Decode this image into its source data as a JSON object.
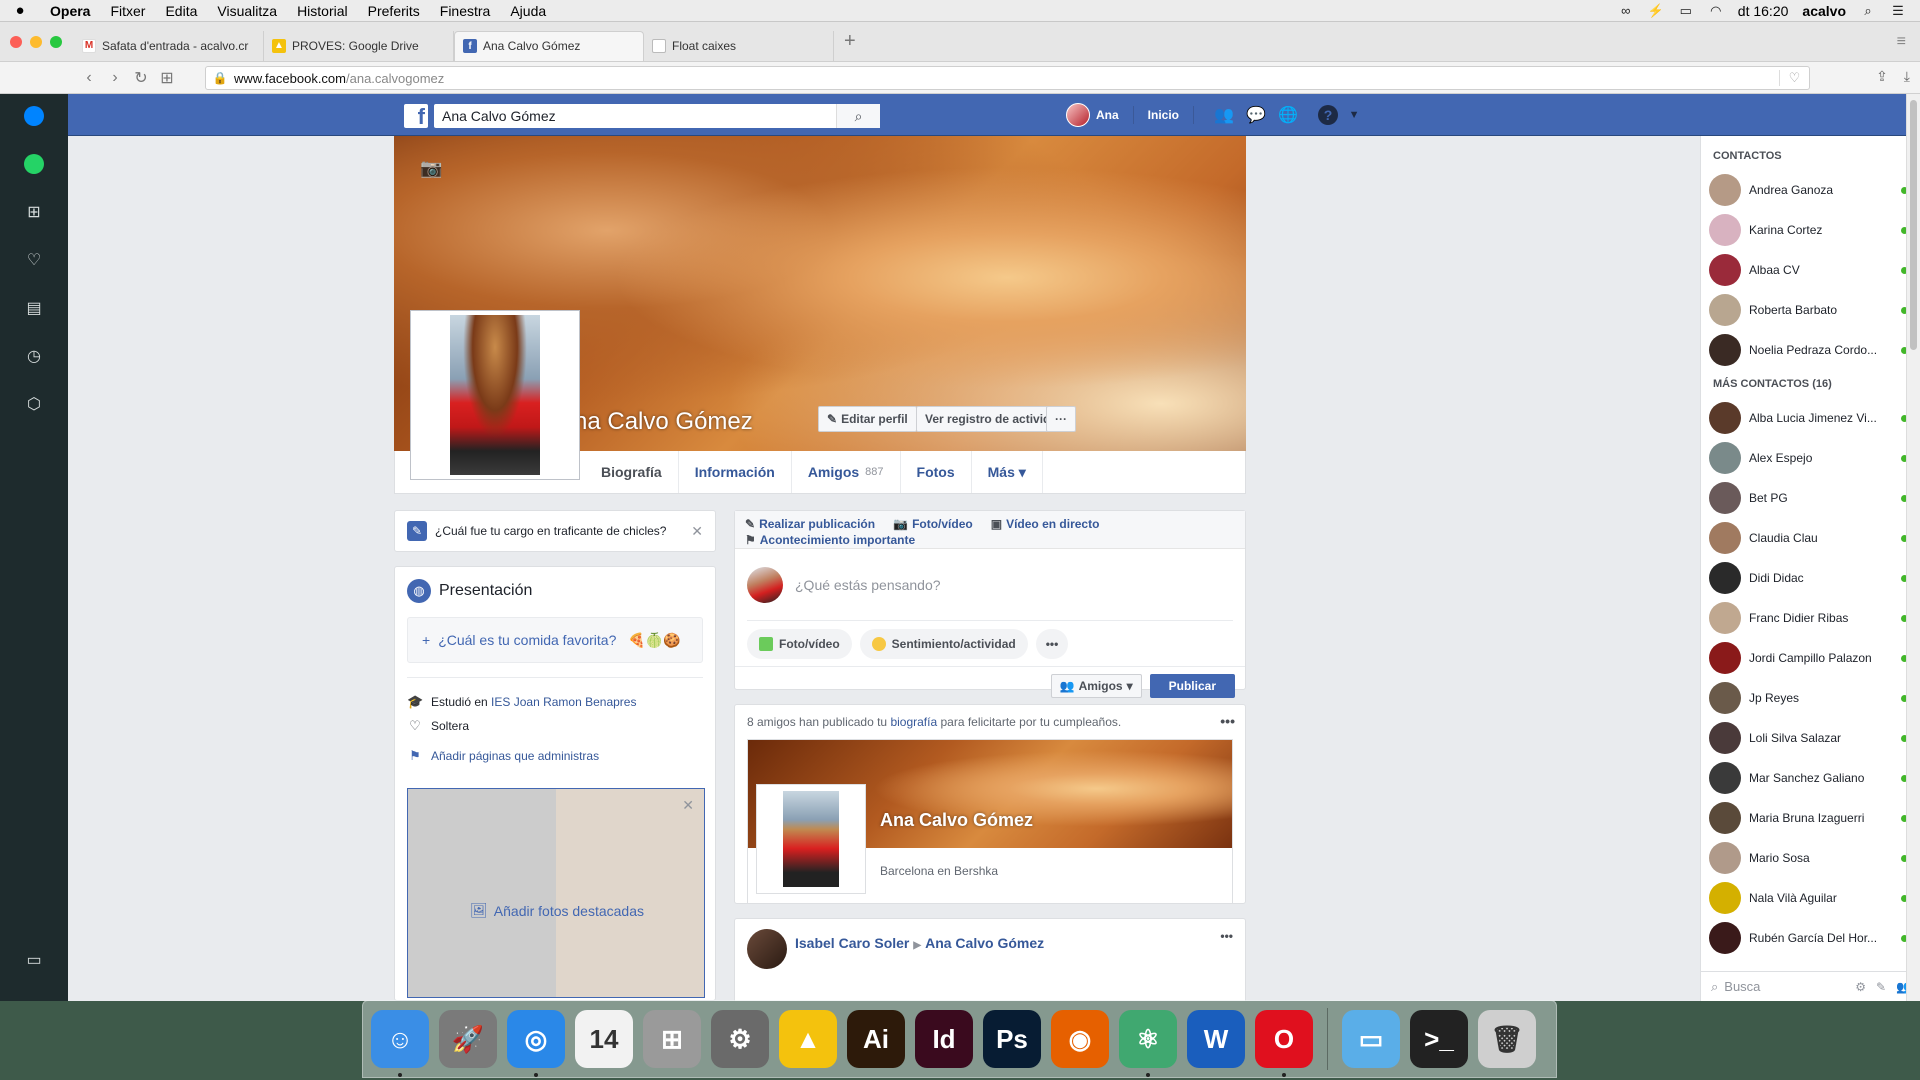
{
  "menubar": {
    "app": "Opera",
    "items": [
      "Fitxer",
      "Edita",
      "Visualitza",
      "Historial",
      "Preferits",
      "Finestra",
      "Ajuda"
    ],
    "clock": "dt 16:20",
    "user": "acalvo"
  },
  "tabs": [
    {
      "label": "Safata d'entrada - acalvo.cr",
      "icon": "gmail-icon",
      "color": "#d93025"
    },
    {
      "label": "PROVES: Google Drive",
      "icon": "google-drive-icon",
      "color": "#1fa463"
    },
    {
      "label": "Ana Calvo Gómez",
      "icon": "facebook-icon",
      "color": "#4267b2"
    },
    {
      "label": "Float caixes",
      "icon": "document-icon",
      "color": "#9aa0a6"
    }
  ],
  "address": {
    "host": "www.facebook.com",
    "path": "/ana.calvogomez"
  },
  "facebook": {
    "search_value": "Ana Calvo Gómez",
    "nav": {
      "user": "Ana",
      "home": "Inicio"
    },
    "profile": {
      "name": "Ana Calvo Gómez",
      "edit_profile": "Editar perfil",
      "activity_log": "Ver registro de actividad",
      "more_dots": "···"
    },
    "timeline_tabs": [
      {
        "label": "Biografía",
        "count": ""
      },
      {
        "label": "Información",
        "count": ""
      },
      {
        "label": "Amigos",
        "count": "887"
      },
      {
        "label": "Fotos",
        "count": ""
      },
      {
        "label": "Más ▾",
        "count": ""
      }
    ],
    "question": "¿Cuál fue tu cargo en traficante de chicles?",
    "intro": {
      "title": "Presentación",
      "prompt": "¿Cuál es tu comida favorita?",
      "studied_prefix": "Estudió en ",
      "school": "IES Joan Ramon Benapres",
      "relationship": "Soltera",
      "pages_link": "Añadir páginas que administras",
      "featured": "Añadir fotos destacadas"
    },
    "composer": {
      "post": "Realizar publicación",
      "photo_video": "Foto/vídeo",
      "live": "Vídeo en directo",
      "life_event": "Acontecimiento importante",
      "placeholder": "¿Qué estás pensando?",
      "photo_pill": "Foto/vídeo",
      "feeling_pill": "Sentimiento/actividad",
      "audience": "Amigos",
      "publish": "Publicar"
    },
    "birthday": {
      "text_prefix": "8 amigos han publicado tu ",
      "text_link": "biografía",
      "text_suffix": " para felicitarte por tu cumpleaños.",
      "name": "Ana Calvo Gómez",
      "subtitle": "Barcelona en Bershka"
    },
    "post": {
      "author": "Isabel Caro Soler",
      "target": "Ana Calvo Gómez"
    },
    "chat": {
      "contacts_heading": "CONTACTOS",
      "contacts": [
        {
          "name": "Andrea Ganoza",
          "color": "#b59a86"
        },
        {
          "name": "Karina Cortez",
          "color": "#d8b2c0"
        },
        {
          "name": "Albaa CV",
          "color": "#9a2a3a"
        },
        {
          "name": "Roberta Barbato",
          "color": "#b8a690"
        },
        {
          "name": "Noelia Pedraza Cordo...",
          "color": "#3a2a24"
        }
      ],
      "more_heading": "MÁS CONTACTOS (16)",
      "more_contacts": [
        {
          "name": "Alba Lucia Jimenez Vi...",
          "color": "#5a3a2a"
        },
        {
          "name": "Alex Espejo",
          "color": "#7a8a8a"
        },
        {
          "name": "Bet PG",
          "color": "#6a5a5a"
        },
        {
          "name": "Claudia Clau",
          "color": "#a07a60"
        },
        {
          "name": "Didi Didac",
          "color": "#2a2a2a"
        },
        {
          "name": "Franc Didier Ribas",
          "color": "#c0a890"
        },
        {
          "name": "Jordi Campillo Palazon",
          "color": "#8a1a1a"
        },
        {
          "name": "Jp Reyes",
          "color": "#6a5a4a"
        },
        {
          "name": "Loli Silva Salazar",
          "color": "#4a3a3a"
        },
        {
          "name": "Mar Sanchez Galiano",
          "color": "#3a3a3a"
        },
        {
          "name": "Maria Bruna Izaguerri",
          "color": "#5a4a3a"
        },
        {
          "name": "Mario Sosa",
          "color": "#b09a8a"
        },
        {
          "name": "Nala Vilà Aguilar",
          "color": "#d4b000"
        },
        {
          "name": "Rubén García Del Hor...",
          "color": "#3a1a1a"
        }
      ],
      "search_placeholder": "Busca"
    }
  },
  "dock": [
    {
      "name": "finder-icon",
      "color": "#3a8ee6",
      "glyph": "☺",
      "running": true
    },
    {
      "name": "launchpad-icon",
      "color": "#7a7a7a",
      "glyph": "🚀",
      "running": false
    },
    {
      "name": "safari-icon",
      "color": "#2a88e8",
      "glyph": "◎",
      "running": true
    },
    {
      "name": "calendar-icon",
      "color": "#f2f2f2",
      "glyph": "14",
      "running": false
    },
    {
      "name": "calculator-icon",
      "color": "#9a9a9a",
      "glyph": "⊞",
      "running": false
    },
    {
      "name": "system-preferences-icon",
      "color": "#6a6a6a",
      "glyph": "⚙",
      "running": false
    },
    {
      "name": "google-drive-icon",
      "color": "#f4c20d",
      "glyph": "▲",
      "running": false
    },
    {
      "name": "illustrator-icon",
      "color": "#2d1a0a",
      "glyph": "Ai",
      "running": false
    },
    {
      "name": "indesign-icon",
      "color": "#3a0a1e",
      "glyph": "Id",
      "running": false
    },
    {
      "name": "photoshop-icon",
      "color": "#071c33",
      "glyph": "Ps",
      "running": false
    },
    {
      "name": "firefox-icon",
      "color": "#e66000",
      "glyph": "◉",
      "running": false
    },
    {
      "name": "atom-icon",
      "color": "#40a870",
      "glyph": "⚛",
      "running": true
    },
    {
      "name": "word-icon",
      "color": "#1a5ebd",
      "glyph": "W",
      "running": false
    },
    {
      "name": "opera-icon",
      "color": "#e0101e",
      "glyph": "O",
      "running": true
    },
    {
      "name": "folder-icon",
      "color": "#5aaee8",
      "glyph": "▭",
      "running": false
    },
    {
      "name": "terminal-icon",
      "color": "#222222",
      "glyph": ">_",
      "running": false
    },
    {
      "name": "trash-icon",
      "color": "#cfcfcf",
      "glyph": "🗑",
      "running": false
    }
  ]
}
